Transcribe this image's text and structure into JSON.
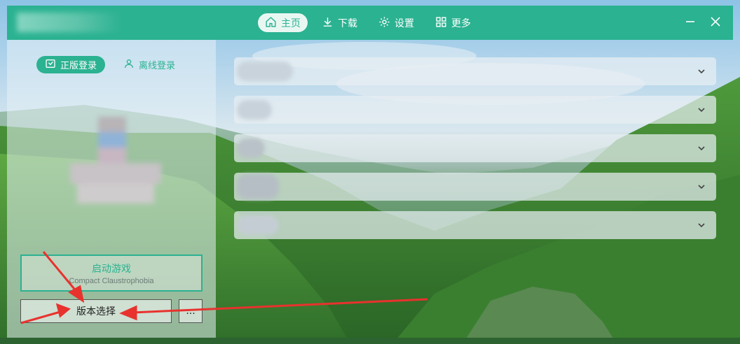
{
  "nav": {
    "items": [
      {
        "label": "主页",
        "icon": "home-icon",
        "active": true
      },
      {
        "label": "下载",
        "icon": "download-icon",
        "active": false
      },
      {
        "label": "设置",
        "icon": "gear-icon",
        "active": false
      },
      {
        "label": "更多",
        "icon": "grid-icon",
        "active": false
      }
    ]
  },
  "login": {
    "official_label": "正版登录",
    "offline_label": "离线登录"
  },
  "launch": {
    "title": "启动游戏",
    "subtitle": "Compact Claustrophobia"
  },
  "version": {
    "select_label": "版本选择",
    "more_label": "..."
  },
  "colors": {
    "accent": "#2bb291",
    "annotation": "#e8322e"
  }
}
